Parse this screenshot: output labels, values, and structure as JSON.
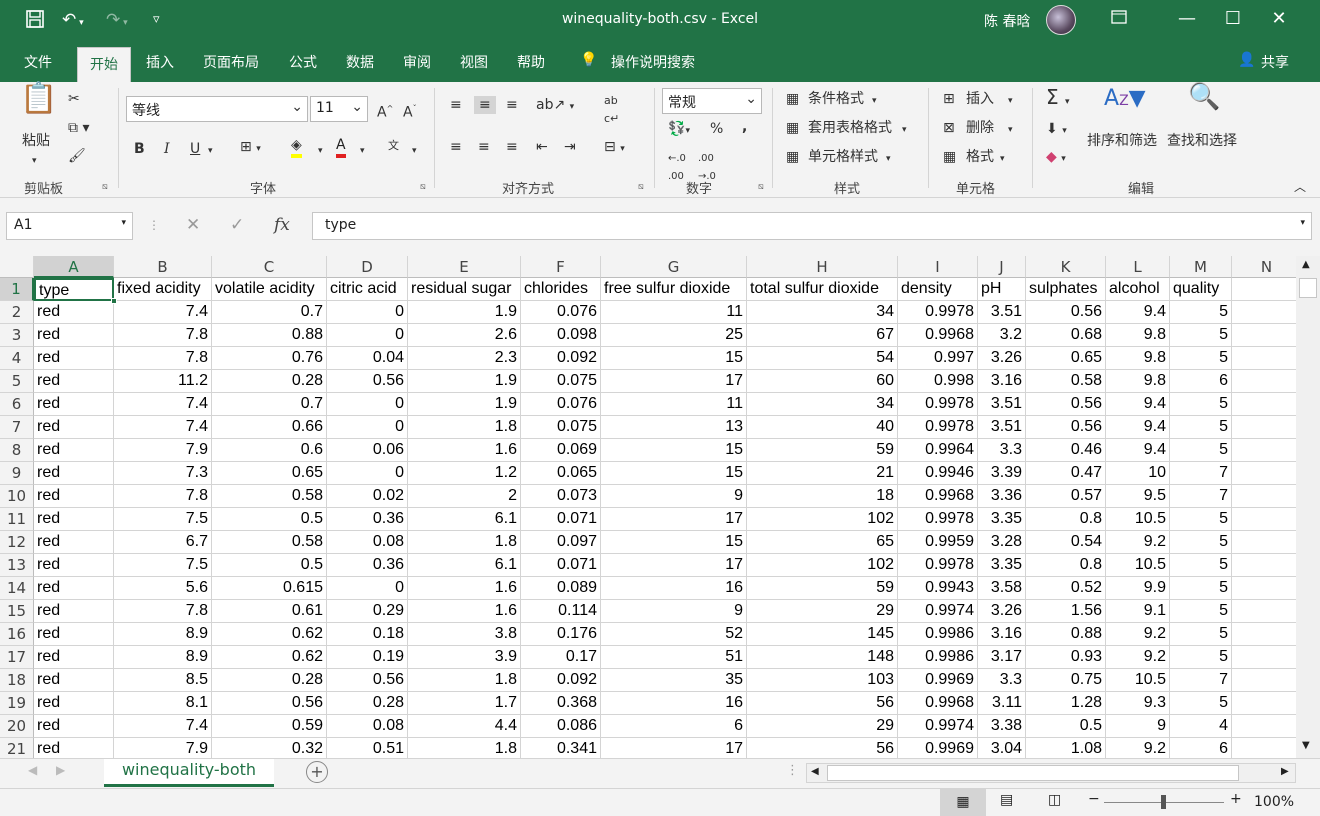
{
  "titlebar": {
    "title": "winequality-both.csv  -  Excel",
    "user": "陈 春晗",
    "save_icon": "save-icon",
    "undo_icon": "undo-icon",
    "redo_icon": "redo-icon",
    "customize_icon": "customize-qat-icon"
  },
  "tabs": [
    "文件",
    "开始",
    "插入",
    "页面布局",
    "公式",
    "数据",
    "审阅",
    "视图",
    "帮助"
  ],
  "active_tab": "开始",
  "tell_me": "操作说明搜索",
  "share": "共享",
  "ribbon": {
    "clipboard": {
      "label": "剪贴板",
      "paste": "粘贴"
    },
    "font": {
      "label": "字体",
      "font_name": "等线",
      "font_size": "11",
      "bold": "B",
      "italic": "I",
      "underline": "U"
    },
    "alignment": {
      "label": "对齐方式"
    },
    "number": {
      "label": "数字",
      "format": "常规"
    },
    "styles": {
      "label": "样式",
      "conditional": "条件格式",
      "table": "套用表格格式",
      "cell": "单元格样式"
    },
    "cells": {
      "label": "单元格",
      "insert": "插入",
      "delete": "删除",
      "format": "格式"
    },
    "editing": {
      "label": "编辑",
      "sort": "排序和筛选",
      "find": "查找和选择"
    }
  },
  "formula_bar": {
    "name_box": "A1",
    "formula": "type"
  },
  "columns": [
    "A",
    "B",
    "C",
    "D",
    "E",
    "F",
    "G",
    "H",
    "I",
    "J",
    "K",
    "L",
    "M",
    "N"
  ],
  "header_row": [
    "type",
    "fixed acidity",
    "volatile acidity",
    "citric acid",
    "residual sugar",
    "chlorides",
    "free sulfur dioxide",
    "total sulfur dioxide",
    "density",
    "pH",
    "sulphates",
    "alcohol",
    "quality"
  ],
  "rows": [
    [
      "red",
      "7.4",
      "0.7",
      "0",
      "1.9",
      "0.076",
      "11",
      "34",
      "0.9978",
      "3.51",
      "0.56",
      "9.4",
      "5"
    ],
    [
      "red",
      "7.8",
      "0.88",
      "0",
      "2.6",
      "0.098",
      "25",
      "67",
      "0.9968",
      "3.2",
      "0.68",
      "9.8",
      "5"
    ],
    [
      "red",
      "7.8",
      "0.76",
      "0.04",
      "2.3",
      "0.092",
      "15",
      "54",
      "0.997",
      "3.26",
      "0.65",
      "9.8",
      "5"
    ],
    [
      "red",
      "11.2",
      "0.28",
      "0.56",
      "1.9",
      "0.075",
      "17",
      "60",
      "0.998",
      "3.16",
      "0.58",
      "9.8",
      "6"
    ],
    [
      "red",
      "7.4",
      "0.7",
      "0",
      "1.9",
      "0.076",
      "11",
      "34",
      "0.9978",
      "3.51",
      "0.56",
      "9.4",
      "5"
    ],
    [
      "red",
      "7.4",
      "0.66",
      "0",
      "1.8",
      "0.075",
      "13",
      "40",
      "0.9978",
      "3.51",
      "0.56",
      "9.4",
      "5"
    ],
    [
      "red",
      "7.9",
      "0.6",
      "0.06",
      "1.6",
      "0.069",
      "15",
      "59",
      "0.9964",
      "3.3",
      "0.46",
      "9.4",
      "5"
    ],
    [
      "red",
      "7.3",
      "0.65",
      "0",
      "1.2",
      "0.065",
      "15",
      "21",
      "0.9946",
      "3.39",
      "0.47",
      "10",
      "7"
    ],
    [
      "red",
      "7.8",
      "0.58",
      "0.02",
      "2",
      "0.073",
      "9",
      "18",
      "0.9968",
      "3.36",
      "0.57",
      "9.5",
      "7"
    ],
    [
      "red",
      "7.5",
      "0.5",
      "0.36",
      "6.1",
      "0.071",
      "17",
      "102",
      "0.9978",
      "3.35",
      "0.8",
      "10.5",
      "5"
    ],
    [
      "red",
      "6.7",
      "0.58",
      "0.08",
      "1.8",
      "0.097",
      "15",
      "65",
      "0.9959",
      "3.28",
      "0.54",
      "9.2",
      "5"
    ],
    [
      "red",
      "7.5",
      "0.5",
      "0.36",
      "6.1",
      "0.071",
      "17",
      "102",
      "0.9978",
      "3.35",
      "0.8",
      "10.5",
      "5"
    ],
    [
      "red",
      "5.6",
      "0.615",
      "0",
      "1.6",
      "0.089",
      "16",
      "59",
      "0.9943",
      "3.58",
      "0.52",
      "9.9",
      "5"
    ],
    [
      "red",
      "7.8",
      "0.61",
      "0.29",
      "1.6",
      "0.114",
      "9",
      "29",
      "0.9974",
      "3.26",
      "1.56",
      "9.1",
      "5"
    ],
    [
      "red",
      "8.9",
      "0.62",
      "0.18",
      "3.8",
      "0.176",
      "52",
      "145",
      "0.9986",
      "3.16",
      "0.88",
      "9.2",
      "5"
    ],
    [
      "red",
      "8.9",
      "0.62",
      "0.19",
      "3.9",
      "0.17",
      "51",
      "148",
      "0.9986",
      "3.17",
      "0.93",
      "9.2",
      "5"
    ],
    [
      "red",
      "8.5",
      "0.28",
      "0.56",
      "1.8",
      "0.092",
      "35",
      "103",
      "0.9969",
      "3.3",
      "0.75",
      "10.5",
      "7"
    ],
    [
      "red",
      "8.1",
      "0.56",
      "0.28",
      "1.7",
      "0.368",
      "16",
      "56",
      "0.9968",
      "3.11",
      "1.28",
      "9.3",
      "5"
    ],
    [
      "red",
      "7.4",
      "0.59",
      "0.08",
      "4.4",
      "0.086",
      "6",
      "29",
      "0.9974",
      "3.38",
      "0.5",
      "9",
      "4"
    ],
    [
      "red",
      "7.9",
      "0.32",
      "0.51",
      "1.8",
      "0.341",
      "17",
      "56",
      "0.9969",
      "3.04",
      "1.08",
      "9.2",
      "6"
    ]
  ],
  "sheet_tab": "winequality-both",
  "zoom": "100%",
  "colors": {
    "accent": "#217346"
  }
}
